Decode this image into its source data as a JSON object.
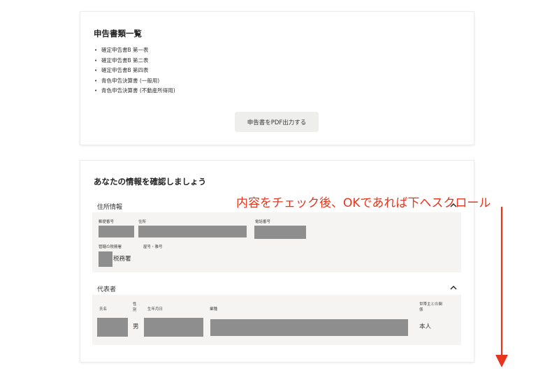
{
  "documents_card": {
    "title": "申告書類一覧",
    "items": [
      "確定申告書B 第一表",
      "確定申告書B 第二表",
      "確定申告書B 第四表",
      "青色申告決算書 (一般用)",
      "青色申告決算書 (不動産所得用)"
    ],
    "pdf_button_label": "申告書をPDF出力する"
  },
  "info_card": {
    "title": "あなたの情報を確認しましょう",
    "address_section": {
      "heading": "住所情報",
      "labels": {
        "postal": "郵便番号",
        "address": "住所",
        "phone": "電話番号",
        "tax_office": "管轄の税務署",
        "building": "屋号・雅号"
      },
      "tax_office_suffix": "税務署"
    },
    "representative_section": {
      "heading": "代表者",
      "labels": {
        "name": "氏名",
        "gender": "性別",
        "birthdate": "生年月日",
        "occupation": "業種",
        "relation": "世帯主との関係"
      },
      "gender_value": "男",
      "relation_value": "本人"
    }
  },
  "annotation": {
    "text": "内容をチェック後、OKであれば下へスクロール",
    "color": "#e8341c"
  }
}
